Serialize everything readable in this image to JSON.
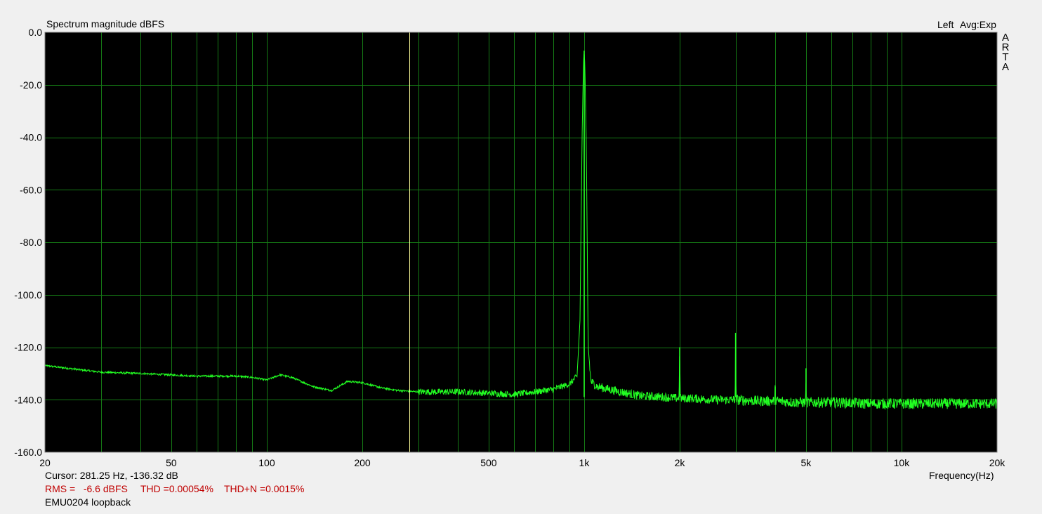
{
  "header": {
    "title": "Spectrum magnitude dBFS",
    "channel": "Left",
    "averaging": "Avg:Exp",
    "brand_letters": [
      "A",
      "R",
      "T",
      "A"
    ]
  },
  "footer": {
    "cursor": "Cursor: 281.25 Hz, -136.32 dB",
    "rms": "RMS =   -6.6 dBFS",
    "thd": "THD =0.00054%",
    "thdn": "THD+N =0.0015%",
    "device": "EMU0204 loopback",
    "xlabel": "Frequency(Hz)"
  },
  "colors": {
    "plot_bg": "#000000",
    "grid": "#157a15",
    "trace": "#22ff22",
    "cursor": "#ffff99",
    "stats_text": "#c00000",
    "page_bg": "#f0f0f0"
  },
  "chart_data": {
    "type": "line",
    "title": "Spectrum magnitude dBFS",
    "xlabel": "Frequency(Hz)",
    "ylabel": "",
    "x_scale": "log",
    "xlim": [
      20,
      20000
    ],
    "ylim": [
      -160,
      0
    ],
    "grid": true,
    "x_ticks": [
      {
        "value": 20,
        "label": "20"
      },
      {
        "value": 50,
        "label": "50"
      },
      {
        "value": 100,
        "label": "100"
      },
      {
        "value": 200,
        "label": "200"
      },
      {
        "value": 500,
        "label": "500"
      },
      {
        "value": 1000,
        "label": "1k"
      },
      {
        "value": 2000,
        "label": "2k"
      },
      {
        "value": 5000,
        "label": "5k"
      },
      {
        "value": 10000,
        "label": "10k"
      },
      {
        "value": 20000,
        "label": "20k"
      }
    ],
    "y_ticks": [
      {
        "value": 0,
        "label": "0.0"
      },
      {
        "value": -20,
        "label": "-20.0"
      },
      {
        "value": -40,
        "label": "-40.0"
      },
      {
        "value": -60,
        "label": "-60.0"
      },
      {
        "value": -80,
        "label": "-80.0"
      },
      {
        "value": -100,
        "label": "-100.0"
      },
      {
        "value": -120,
        "label": "-120.0"
      },
      {
        "value": -140,
        "label": "-140.0"
      },
      {
        "value": -160,
        "label": "-160.0"
      }
    ],
    "cursor": {
      "frequency": 281.25,
      "level": -136.32
    },
    "series": [
      {
        "color": "#22ff22",
        "x": [
          20,
          30,
          40,
          60,
          80,
          90,
          100,
          110,
          120,
          140,
          160,
          180,
          200,
          230,
          260,
          300,
          400,
          500,
          600,
          700,
          800,
          900,
          950,
          970,
          985,
          995,
          1000,
          1005,
          1015,
          1030,
          1050,
          1100,
          1300,
          1500,
          1800,
          1990,
          2000,
          2010,
          2200,
          2600,
          2990,
          3000,
          3010,
          3500,
          3990,
          4000,
          4010,
          4600,
          4990,
          5000,
          5010,
          6000,
          8000,
          10000,
          13000,
          16000,
          20000
        ],
        "y": [
          -127,
          -129.5,
          -130,
          -131,
          -131,
          -131.5,
          -132.5,
          -130.5,
          -131.5,
          -135,
          -136.5,
          -133,
          -133.5,
          -135.5,
          -136.5,
          -137,
          -137,
          -137.5,
          -138,
          -137,
          -136,
          -134,
          -131,
          -110,
          -40,
          -12,
          -7,
          -12,
          -40,
          -120,
          -133,
          -135,
          -137,
          -138.5,
          -139,
          -139.5,
          -120,
          -139.5,
          -139.5,
          -140,
          -140,
          -114.5,
          -140,
          -140.5,
          -140.5,
          -135,
          -140.5,
          -141,
          -141,
          -128,
          -141,
          -141,
          -141.5,
          -141.5,
          -141.5,
          -141.5,
          -141.5
        ]
      }
    ]
  }
}
